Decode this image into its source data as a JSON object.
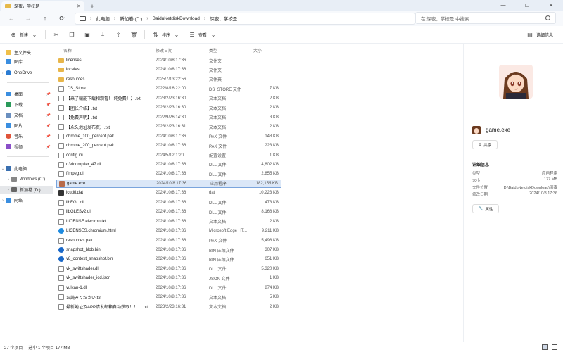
{
  "window": {
    "tab_title": "深夜，学校是",
    "new_tab": "+",
    "minimize": "—",
    "maximize": "☐",
    "close": "✕"
  },
  "address": {
    "crumbs": [
      "此电脑",
      "新加卷 (D:)",
      "BaiduNetdiskDownload",
      "深夜，学校是"
    ],
    "search_placeholder": "在 深夜，学校是 中搜索"
  },
  "toolbar": {
    "new": "新建",
    "sort": "排序",
    "view": "查看",
    "more": "···",
    "details": "详细信息"
  },
  "sidebar": {
    "items": [
      {
        "label": "主文件夹"
      },
      {
        "label": "图库"
      },
      {
        "label": "OneDrive"
      },
      {
        "label": "桌面"
      },
      {
        "label": "下载"
      },
      {
        "label": "文档"
      },
      {
        "label": "图片"
      },
      {
        "label": "音乐"
      },
      {
        "label": "视频"
      },
      {
        "label": "此电脑"
      },
      {
        "label": "Windows (C:)"
      },
      {
        "label": "新加卷 (D:)"
      },
      {
        "label": "网络"
      }
    ]
  },
  "columns": {
    "name": "名称",
    "date": "修改日期",
    "type": "类型",
    "size": "大小"
  },
  "files": [
    {
      "name": "licenses",
      "date": "2024/10/8 17:36",
      "type": "文件夹",
      "size": "",
      "icon": "folder"
    },
    {
      "name": "locales",
      "date": "2024/10/8 17:36",
      "type": "文件夹",
      "size": "",
      "icon": "folder"
    },
    {
      "name": "resources",
      "date": "2025/7/13 22:56",
      "type": "文件夹",
      "size": "",
      "icon": "folder"
    },
    {
      "name": ".DS_Store",
      "date": "2022/8/16 22:00",
      "type": "DS_STORE 文件",
      "size": "7 KB",
      "icon": "file"
    },
    {
      "name": "【来了骗能下载和观看！ 纯免费！】.txt",
      "date": "2023/2/23 16:30",
      "type": "文本文档",
      "size": "2 KB",
      "icon": "file"
    },
    {
      "name": "【团长介绍】.txt",
      "date": "2023/2/23 16:30",
      "type": "文本文档",
      "size": "2 KB",
      "icon": "file"
    },
    {
      "name": "【免费声明】.txt",
      "date": "2022/9/26 14:30",
      "type": "文本文档",
      "size": "3 KB",
      "icon": "file"
    },
    {
      "name": "【永久地址发布页】.txt",
      "date": "2023/2/23 16:31",
      "type": "文本文档",
      "size": "2 KB",
      "icon": "file"
    },
    {
      "name": "chrome_100_percent.pak",
      "date": "2024/10/8 17:36",
      "type": "PAK 文件",
      "size": "148 KB",
      "icon": "file"
    },
    {
      "name": "chrome_200_percent.pak",
      "date": "2024/10/8 17:36",
      "type": "PAK 文件",
      "size": "223 KB",
      "icon": "file"
    },
    {
      "name": "config.ini",
      "date": "2024/5/12 1:20",
      "type": "配置设置",
      "size": "1 KB",
      "icon": "file"
    },
    {
      "name": "d3dcompiler_47.dll",
      "date": "2024/10/8 17:36",
      "type": "DLL 文件",
      "size": "4,802 KB",
      "icon": "file"
    },
    {
      "name": "ffmpeg.dll",
      "date": "2024/10/8 17:36",
      "type": "DLL 文件",
      "size": "2,855 KB",
      "icon": "file"
    },
    {
      "name": "game.exe",
      "date": "2024/10/8 17:36",
      "type": "应用程序",
      "size": "182,155 KB",
      "icon": "exe",
      "selected": true
    },
    {
      "name": "icudtl.dat",
      "date": "2024/10/8 17:36",
      "type": "dat",
      "size": "10,223 KB",
      "icon": "dat"
    },
    {
      "name": "libEGL.dll",
      "date": "2024/10/8 17:36",
      "type": "DLL 文件",
      "size": "473 KB",
      "icon": "file"
    },
    {
      "name": "libGLESv2.dll",
      "date": "2024/10/8 17:36",
      "type": "DLL 文件",
      "size": "8,168 KB",
      "icon": "file"
    },
    {
      "name": "LICENSE.electron.txt",
      "date": "2024/10/8 17:36",
      "type": "文本文档",
      "size": "2 KB",
      "icon": "file"
    },
    {
      "name": "LICENSES.chromium.html",
      "date": "2024/10/8 17:36",
      "type": "Microsoft Edge HT...",
      "size": "9,211 KB",
      "icon": "edge"
    },
    {
      "name": "resources.pak",
      "date": "2024/10/8 17:36",
      "type": "PAK 文件",
      "size": "5,498 KB",
      "icon": "file"
    },
    {
      "name": "snapshot_blob.bin",
      "date": "2024/10/8 17:36",
      "type": "BIN 压缩文件",
      "size": "307 KB",
      "icon": "bin"
    },
    {
      "name": "v8_context_snapshot.bin",
      "date": "2024/10/8 17:36",
      "type": "BIN 压缩文件",
      "size": "651 KB",
      "icon": "bin"
    },
    {
      "name": "vk_swiftshader.dll",
      "date": "2024/10/8 17:36",
      "type": "DLL 文件",
      "size": "5,320 KB",
      "icon": "file"
    },
    {
      "name": "vk_swiftshader_icd.json",
      "date": "2024/10/8 17:36",
      "type": "JSON 文件",
      "size": "1 KB",
      "icon": "file"
    },
    {
      "name": "vulkan-1.dll",
      "date": "2024/10/8 17:36",
      "type": "DLL 文件",
      "size": "874 KB",
      "icon": "file"
    },
    {
      "name": "お読みください.txt",
      "date": "2024/10/8 17:36",
      "type": "文本文档",
      "size": "5 KB",
      "icon": "file"
    },
    {
      "name": "最新地址及APP请发邮箱自动获取！！！.txt",
      "date": "2023/2/23 16:31",
      "type": "文本文档",
      "size": "2 KB",
      "icon": "file"
    }
  ],
  "details": {
    "filename": "game.exe",
    "share": "共享",
    "section": "详细信息",
    "props": [
      {
        "label": "类型",
        "value": "应用程序"
      },
      {
        "label": "大小",
        "value": "177 MB"
      },
      {
        "label": "文件位置",
        "value": "D:\\BaiduNetdiskDownload\\深夜"
      },
      {
        "label": "修改日期",
        "value": "2024/10/8 17:36"
      }
    ],
    "properties_btn": "属性"
  },
  "status": {
    "count": "27 个项目",
    "selected": "选中 1 个项目 177 MB"
  },
  "colors": {
    "accent": "#0067c0",
    "selected_bg": "#dbe7f7",
    "folder": "#e8b64a"
  }
}
